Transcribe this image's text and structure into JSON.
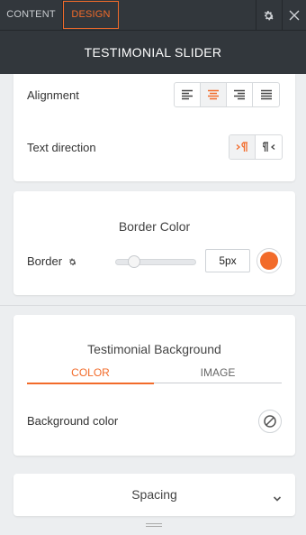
{
  "tabs": {
    "content": "CONTENT",
    "design": "DESIGN"
  },
  "header": {
    "title": "TESTIMONIAL SLIDER"
  },
  "alignment": {
    "label": "Alignment",
    "options": [
      "align-left",
      "align-center",
      "align-right",
      "align-justify"
    ],
    "selected": "align-center"
  },
  "text_direction": {
    "label": "Text direction",
    "options": [
      "ltr",
      "rtl"
    ],
    "selected": "ltr"
  },
  "border_color": {
    "title": "Border Color",
    "border_label": "Border",
    "value": "5px",
    "color": "#f26b2a",
    "slider_fraction": 0.1
  },
  "background": {
    "title": "Testimonial Background",
    "tabs": [
      "COLOR",
      "IMAGE"
    ],
    "active_tab": "COLOR",
    "color_label": "Background color"
  },
  "spacing": {
    "label": "Spacing"
  },
  "colors": {
    "accent": "#f26b2a",
    "header_bg": "#32373c"
  }
}
